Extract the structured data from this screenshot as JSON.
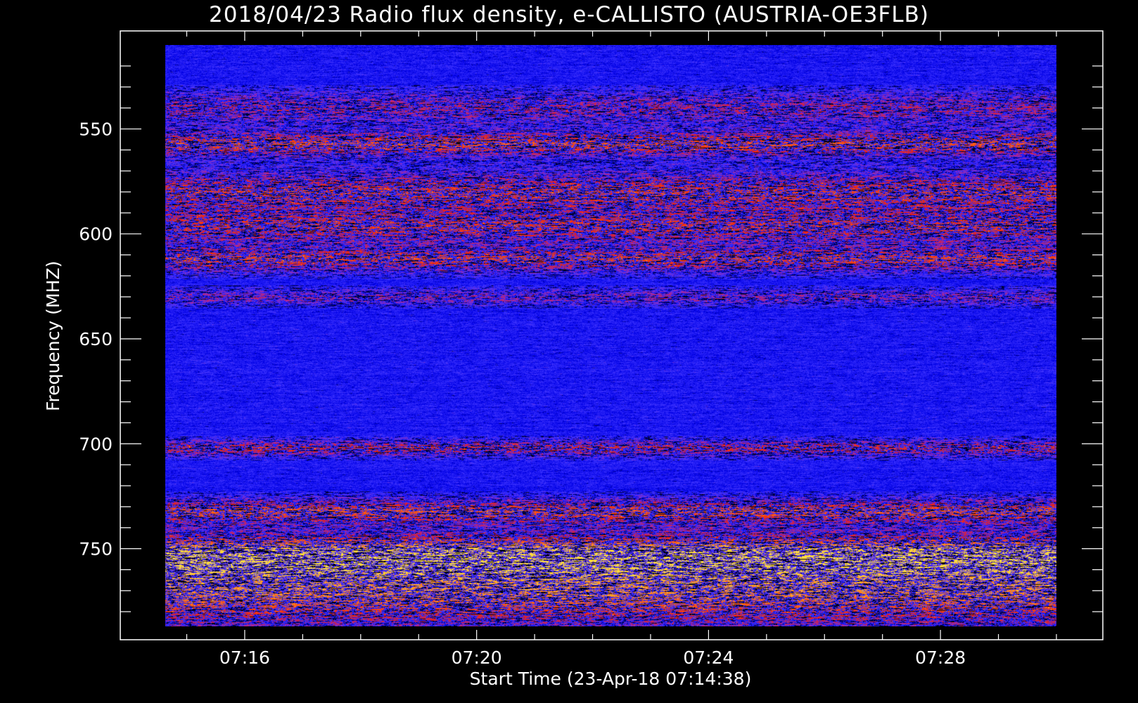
{
  "chart_data": {
    "type": "heatmap",
    "title": "2018/04/23  Radio flux density, e-CALLISTO (AUSTRIA-OE3FLB)",
    "xlabel": "Start Time (23-Apr-18 07:14:38)",
    "ylabel": "Frequency (MHZ)",
    "x_ticks": [
      "07:16",
      "07:20",
      "07:24",
      "07:28"
    ],
    "x_tick_minutes": [
      16,
      20,
      24,
      28
    ],
    "y_ticks": [
      550,
      600,
      650,
      700,
      750
    ],
    "xlim_minutes": [
      14.63,
      30.0
    ],
    "ylim": [
      510,
      787
    ],
    "colormap": [
      "#000000",
      "#0000e6",
      "#3c32ff",
      "#9628b4",
      "#e61e14",
      "#ff6414",
      "#ffdc3c"
    ],
    "bright_bands_mhz": [
      {
        "center": 540,
        "width": 8,
        "intensity": 0.35
      },
      {
        "center": 557,
        "width": 6,
        "intensity": 0.55
      },
      {
        "center": 580,
        "width": 10,
        "intensity": 0.5
      },
      {
        "center": 597,
        "width": 8,
        "intensity": 0.45
      },
      {
        "center": 612,
        "width": 6,
        "intensity": 0.5
      },
      {
        "center": 630,
        "width": 4,
        "intensity": 0.3
      },
      {
        "center": 702,
        "width": 4,
        "intensity": 0.45
      },
      {
        "center": 732,
        "width": 6,
        "intensity": 0.55
      },
      {
        "center": 752,
        "width": 10,
        "intensity": 0.6
      },
      {
        "center": 770,
        "width": 18,
        "intensity": 0.65
      }
    ]
  }
}
